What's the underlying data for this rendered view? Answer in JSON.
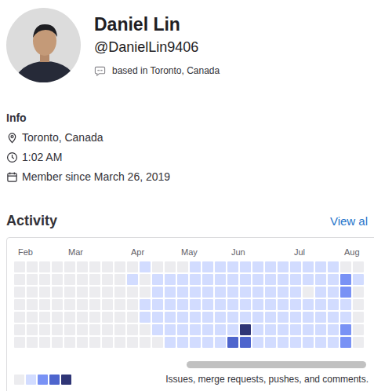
{
  "profile": {
    "name": "Daniel Lin",
    "handle": "@DanielLin9406",
    "status": "based in Toronto, Canada"
  },
  "info": {
    "title": "Info",
    "items": [
      {
        "kind": "location",
        "text": "Toronto, Canada"
      },
      {
        "kind": "time",
        "text": "1:02 AM"
      },
      {
        "kind": "member",
        "text": "Member since March 26, 2019"
      }
    ]
  },
  "activity": {
    "title": "Activity",
    "link": "View al",
    "months": [
      {
        "label": "Feb",
        "week": 0
      },
      {
        "label": "Mar",
        "week": 4
      },
      {
        "label": "Apr",
        "week": 9
      },
      {
        "label": "May",
        "week": 13
      },
      {
        "label": "Jun",
        "week": 17
      },
      {
        "label": "Jul",
        "week": 22
      },
      {
        "label": "Aug",
        "week": 26
      }
    ],
    "weeks": [
      [
        0,
        0,
        0,
        0,
        0,
        0,
        0
      ],
      [
        0,
        0,
        0,
        0,
        0,
        0,
        0
      ],
      [
        0,
        0,
        0,
        0,
        0,
        0,
        0
      ],
      [
        0,
        0,
        0,
        0,
        0,
        0,
        0
      ],
      [
        0,
        0,
        0,
        0,
        0,
        0,
        0
      ],
      [
        0,
        0,
        0,
        0,
        0,
        0,
        0
      ],
      [
        0,
        0,
        0,
        0,
        0,
        0,
        0
      ],
      [
        0,
        0,
        0,
        0,
        0,
        0,
        0
      ],
      [
        0,
        0,
        0,
        0,
        0,
        0,
        0
      ],
      [
        0,
        1,
        0,
        0,
        0,
        0,
        0
      ],
      [
        1,
        0,
        0,
        1,
        1,
        0,
        0
      ],
      [
        0,
        1,
        1,
        1,
        1,
        1,
        0
      ],
      [
        0,
        1,
        1,
        1,
        1,
        1,
        1
      ],
      [
        0,
        1,
        1,
        1,
        1,
        1,
        1
      ],
      [
        1,
        1,
        1,
        1,
        1,
        1,
        1
      ],
      [
        1,
        1,
        1,
        1,
        1,
        1,
        1
      ],
      [
        1,
        1,
        1,
        1,
        1,
        1,
        1
      ],
      [
        1,
        1,
        1,
        1,
        1,
        1,
        3
      ],
      [
        1,
        1,
        1,
        1,
        1,
        4,
        3
      ],
      [
        1,
        1,
        1,
        1,
        1,
        1,
        1
      ],
      [
        1,
        1,
        1,
        1,
        1,
        1,
        1
      ],
      [
        1,
        1,
        1,
        1,
        1,
        1,
        1
      ],
      [
        1,
        1,
        1,
        1,
        1,
        1,
        1
      ],
      [
        1,
        1,
        0,
        1,
        1,
        1,
        1
      ],
      [
        1,
        1,
        1,
        1,
        1,
        1,
        1
      ],
      [
        1,
        1,
        1,
        1,
        1,
        1,
        1
      ],
      [
        0,
        2,
        2,
        1,
        1,
        2,
        2
      ],
      [
        0,
        1,
        0,
        0,
        0,
        0,
        0
      ]
    ],
    "legend": {
      "levels": [
        0,
        1,
        2,
        3,
        4
      ],
      "text": "Issues, merge requests, pushes, and comments."
    }
  }
}
